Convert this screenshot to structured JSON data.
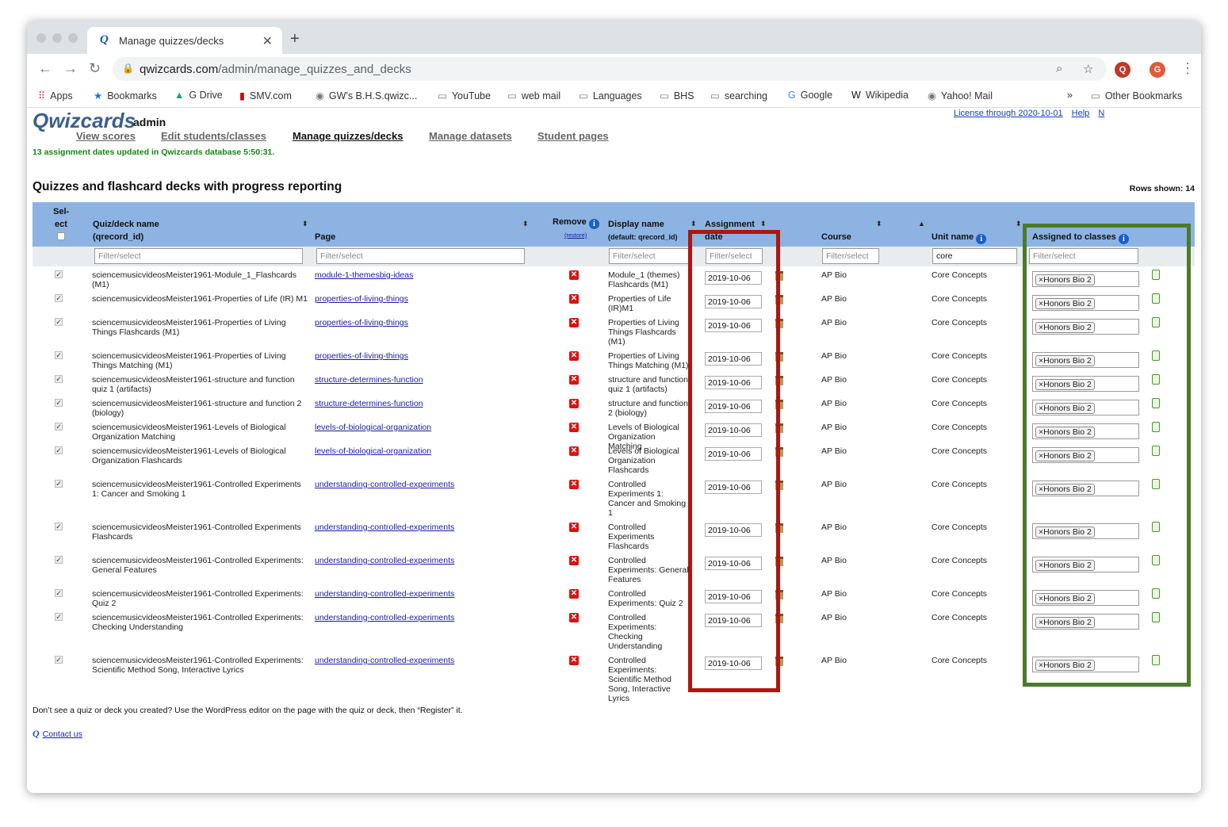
{
  "browser": {
    "tab_title": "Manage quizzes/decks",
    "url_host": "qwizcards.com",
    "url_path": "/admin/manage_quizzes_and_decks",
    "bookmarks": [
      "Apps",
      "Bookmarks",
      "G Drive",
      "SMV.com",
      "GW's B.H.S.qwizc...",
      "YouTube",
      "web mail",
      "Languages",
      "BHS",
      "searching",
      "Google",
      "Wikipedia",
      "Yahoo! Mail",
      "Other Bookmarks"
    ],
    "profile_initial": "G"
  },
  "header": {
    "logo": "Qwizcards",
    "role": "admin",
    "license": "License through 2020-10-01",
    "help": "Help",
    "extra_link": "N",
    "nav": [
      "View scores",
      "Edit students/classes",
      "Manage quizzes/decks",
      "Manage datasets",
      "Student pages"
    ],
    "status": "13 assignment dates updated in Qwizcards database 5:50:31.",
    "title": "Quizzes and flashcard decks with progress reporting",
    "rows_shown": "Rows shown: 14"
  },
  "columns": {
    "select_l1": "Sel-",
    "select_l2": "ect",
    "quiz_l1": "Quiz/deck name",
    "quiz_l2": "(qrecord_id)",
    "page": "Page",
    "remove": "Remove",
    "restore": "(restore)",
    "display_l1": "Display name",
    "display_l2": "(default: qrecord_id)",
    "assign_l1": "Assignment",
    "assign_l2": "date",
    "course": "Course",
    "unit": "Unit name",
    "assigned": "Assigned to classes"
  },
  "filters": {
    "placeholder": "Filter/select",
    "unit_value": "core"
  },
  "rows": [
    {
      "name": "sciencemusicvideosMeister1961-Module_1_Flashcards (M1)",
      "page": "module-1-themesbig-ideas",
      "display": "Module_1 (themes) Flashcards (M1)",
      "date": "2019-10-06",
      "course": "AP Bio",
      "unit": "Core Concepts",
      "class": "Honors Bio 2"
    },
    {
      "name": "sciencemusicvideosMeister1961-Properties of Life (IR) M1",
      "page": "properties-of-living-things",
      "display": "Properties of Life (IR)M1",
      "date": "2019-10-06",
      "course": "AP Bio",
      "unit": "Core Concepts",
      "class": "Honors Bio 2"
    },
    {
      "name": "sciencemusicvideosMeister1961-Properties of Living Things Flashcards (M1)",
      "page": "properties-of-living-things",
      "display": "Properties of Living Things Flashcards (M1)",
      "date": "2019-10-06",
      "course": "AP Bio",
      "unit": "Core Concepts",
      "class": "Honors Bio 2"
    },
    {
      "name": "sciencemusicvideosMeister1961-Properties of Living Things Matching (M1)",
      "page": "properties-of-living-things",
      "display": "Properties of Living Things Matching (M1)",
      "date": "2019-10-06",
      "course": "AP Bio",
      "unit": "Core Concepts",
      "class": "Honors Bio 2"
    },
    {
      "name": "sciencemusicvideosMeister1961-structure and function quiz 1 (artifacts)",
      "page": "structure-determines-function",
      "display": "structure and function quiz 1 (artifacts)",
      "date": "2019-10-06",
      "course": "AP Bio",
      "unit": "Core Concepts",
      "class": "Honors Bio 2"
    },
    {
      "name": "sciencemusicvideosMeister1961-structure and function 2 (biology)",
      "page": "structure-determines-function",
      "display": "structure and function 2 (biology)",
      "date": "2019-10-06",
      "course": "AP Bio",
      "unit": "Core Concepts",
      "class": "Honors Bio 2"
    },
    {
      "name": "sciencemusicvideosMeister1961-Levels of Biological Organization Matching",
      "page": "levels-of-biological-organization",
      "display": "Levels of Biological Organization Matching",
      "date": "2019-10-06",
      "course": "AP Bio",
      "unit": "Core Concepts",
      "class": "Honors Bio 2"
    },
    {
      "name": "sciencemusicvideosMeister1961-Levels of Biological Organization Flashcards",
      "page": "levels-of-biological-organization",
      "display": "Levels of Biological Organization Flashcards",
      "date": "2019-10-06",
      "course": "AP Bio",
      "unit": "Core Concepts",
      "class": "Honors Bio 2"
    },
    {
      "name": "sciencemusicvideosMeister1961-Controlled Experiments 1: Cancer and Smoking 1",
      "page": "understanding-controlled-experiments",
      "display": "Controlled Experiments 1: Cancer and Smoking 1",
      "date": "2019-10-06",
      "course": "AP Bio",
      "unit": "Core Concepts",
      "class": "Honors Bio 2"
    },
    {
      "name": "sciencemusicvideosMeister1961-Controlled Experiments Flashcards",
      "page": "understanding-controlled-experiments",
      "display": "Controlled Experiments Flashcards",
      "date": "2019-10-06",
      "course": "AP Bio",
      "unit": "Core Concepts",
      "class": "Honors Bio 2"
    },
    {
      "name": "sciencemusicvideosMeister1961-Controlled Experiments: General Features",
      "page": "understanding-controlled-experiments",
      "display": "Controlled Experiments: General Features",
      "date": "2019-10-06",
      "course": "AP Bio",
      "unit": "Core Concepts",
      "class": "Honors Bio 2"
    },
    {
      "name": "sciencemusicvideosMeister1961-Controlled Experiments: Quiz 2",
      "page": "understanding-controlled-experiments",
      "display": "Controlled Experiments: Quiz 2",
      "date": "2019-10-06",
      "course": "AP Bio",
      "unit": "Core Concepts",
      "class": "Honors Bio 2"
    },
    {
      "name": "sciencemusicvideosMeister1961-Controlled Experiments: Checking Understanding",
      "page": "understanding-controlled-experiments",
      "display": "Controlled Experiments: Checking Understanding",
      "date": "2019-10-06",
      "course": "AP Bio",
      "unit": "Core Concepts",
      "class": "Honors Bio 2"
    },
    {
      "name": "sciencemusicvideosMeister1961-Controlled Experiments: Scientific Method Song, Interactive Lyrics",
      "page": "understanding-controlled-experiments",
      "display": "Controlled Experiments: Scientific Method Song, Interactive Lyrics",
      "date": "2019-10-06",
      "course": "AP Bio",
      "unit": "Core Concepts",
      "class": "Honors Bio 2"
    }
  ],
  "footer": {
    "note": "Don’t see a quiz or deck you created?  Use the WordPress editor on the page with the quiz or deck, then “Register” it.",
    "contact": "Contact us"
  }
}
